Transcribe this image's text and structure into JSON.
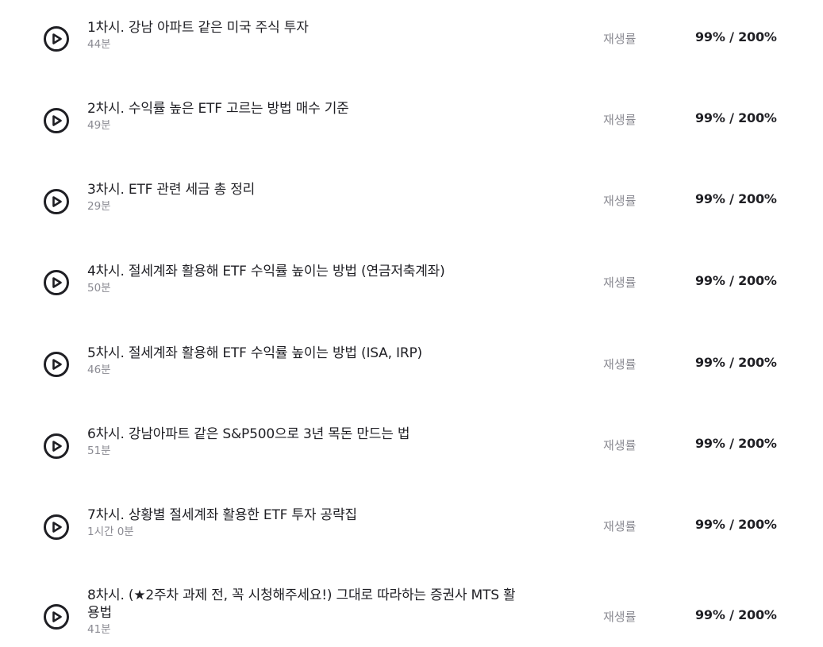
{
  "lessons": [
    {
      "title": "1차시. 강남 아파트 같은 미국 주식 투자",
      "duration": "44분",
      "rate_label": "재생률",
      "rate_value": "99% / 200%"
    },
    {
      "title": "2차시. 수익률 높은 ETF 고르는 방법 매수 기준",
      "duration": "49분",
      "rate_label": "재생률",
      "rate_value": "99% / 200%"
    },
    {
      "title": "3차시. ETF 관련 세금 총 정리",
      "duration": "29분",
      "rate_label": "재생률",
      "rate_value": "99% / 200%"
    },
    {
      "title": "4차시. 절세계좌 활용해 ETF 수익률 높이는 방법 (연금저축계좌)",
      "duration": "50분",
      "rate_label": "재생률",
      "rate_value": "99% / 200%"
    },
    {
      "title": "5차시. 절세계좌 활용해 ETF 수익률 높이는 방법 (ISA, IRP)",
      "duration": "46분",
      "rate_label": "재생률",
      "rate_value": "99% / 200%"
    },
    {
      "title": "6차시. 강남아파트 같은 S&P500으로 3년 목돈 만드는 법",
      "duration": "51분",
      "rate_label": "재생률",
      "rate_value": "99% / 200%"
    },
    {
      "title": "7차시. 상황별 절세계좌 활용한 ETF 투자 공략집",
      "duration": "1시간 0분",
      "rate_label": "재생률",
      "rate_value": "99% / 200%"
    },
    {
      "title": "8차시. (★2주차 과제 전, 꼭 시청해주세요!) 그대로 따라하는 증권사 MTS 활용법",
      "duration": "41분",
      "rate_label": "재생률",
      "rate_value": "99% / 200%"
    }
  ],
  "icon": "play-circle-icon",
  "colors": {
    "text": "#1f1f24",
    "muted": "#8a8a92"
  }
}
